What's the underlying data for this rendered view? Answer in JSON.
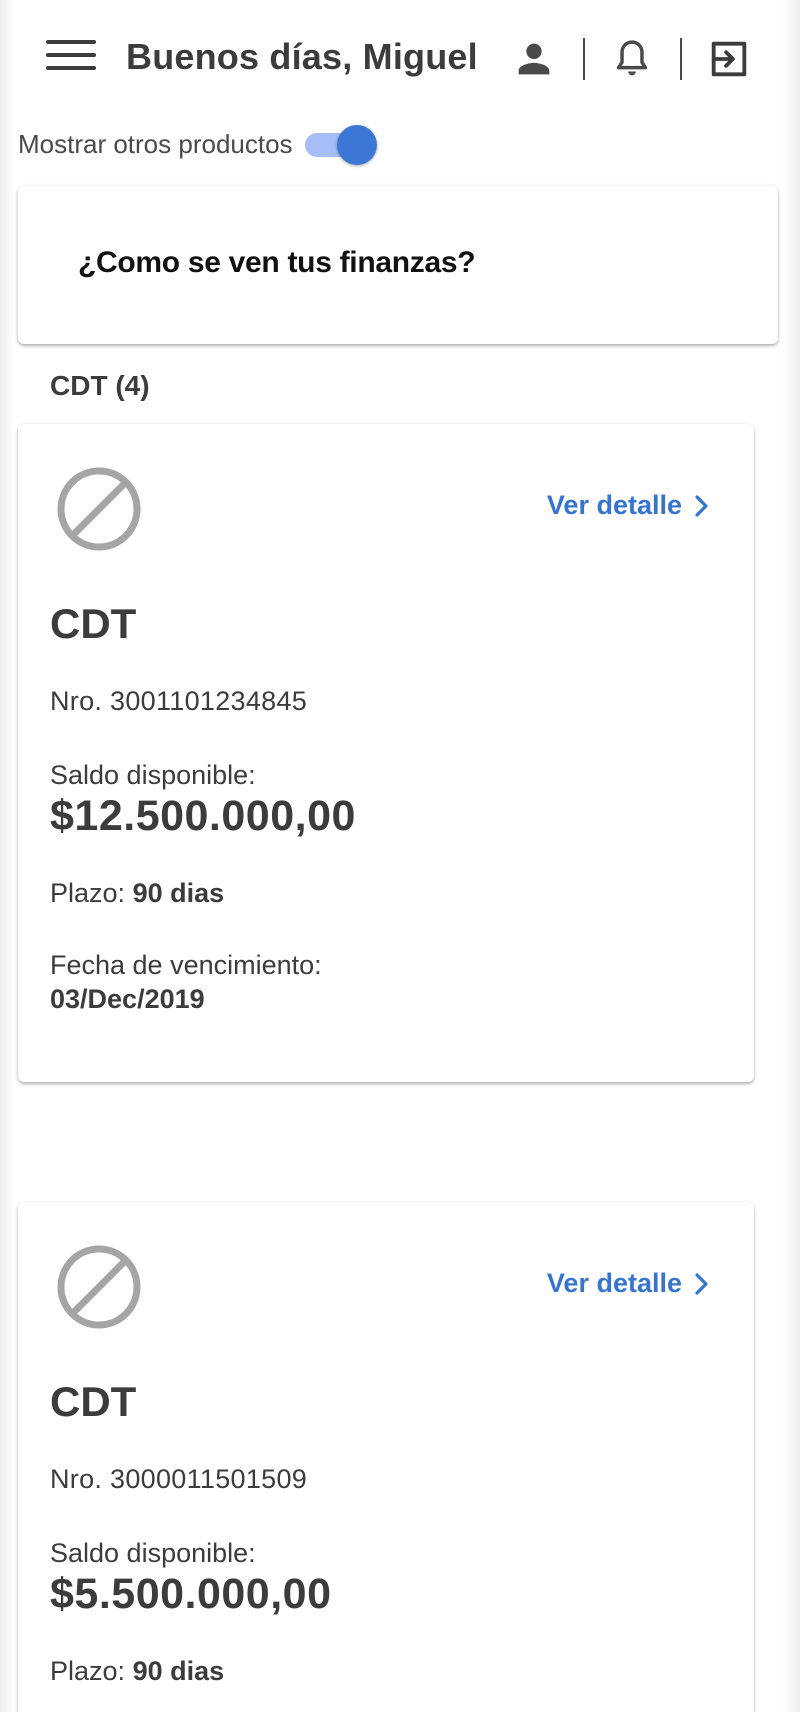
{
  "header": {
    "greeting": "Buenos días, Miguel",
    "icons": [
      "menu-icon",
      "user-icon",
      "bell-icon",
      "logout-icon"
    ]
  },
  "toggle": {
    "label": "Mostrar otros productos",
    "checked": true,
    "colors": {
      "track": "#a7bdf5",
      "knob": "#3b78d6"
    }
  },
  "finance_card": {
    "title": "¿Como se ven tus finanzas?"
  },
  "section": {
    "title": "CDT (4)"
  },
  "products": [
    {
      "icon": "block-icon",
      "detail_label": "Ver detalle",
      "name": "CDT",
      "number": "Nro. 3001101234845",
      "balance_label": "Saldo disponible:",
      "balance": "$12.500.000,00",
      "term_label": "Plazo:",
      "term_value": "90 dias",
      "due_label": "Fecha de vencimiento:",
      "due_value": "03/Dec/2019"
    },
    {
      "icon": "block-icon",
      "detail_label": "Ver detalle",
      "name": "CDT",
      "number": "Nro. 3000011501509",
      "balance_label": "Saldo disponible:",
      "balance": "$5.500.000,00",
      "term_label": "Plazo:",
      "term_value": "90 dias"
    }
  ],
  "colors": {
    "text": "#3c3c3c",
    "link": "#3575d0",
    "icon_gray": "#a5a5a5"
  }
}
